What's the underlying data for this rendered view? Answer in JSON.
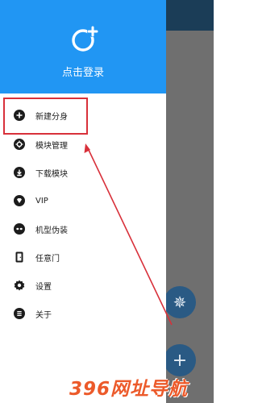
{
  "header": {
    "login_text": "点击登录",
    "accent": "#2196f3"
  },
  "menu": {
    "items": [
      {
        "label": "新建分身",
        "icon": "plus-circle-icon"
      },
      {
        "label": "模块管理",
        "icon": "gear-icon"
      },
      {
        "label": "下载模块",
        "icon": "download-icon"
      },
      {
        "label": "VIP",
        "icon": "diamond-icon"
      },
      {
        "label": "机型伪装",
        "icon": "mask-icon"
      },
      {
        "label": "任意门",
        "icon": "door-icon"
      },
      {
        "label": "设置",
        "icon": "settings-icon"
      },
      {
        "label": "关于",
        "icon": "info-icon"
      }
    ]
  },
  "fabs": {
    "gear": "✵",
    "add": "+"
  },
  "watermark": "396网址导航"
}
